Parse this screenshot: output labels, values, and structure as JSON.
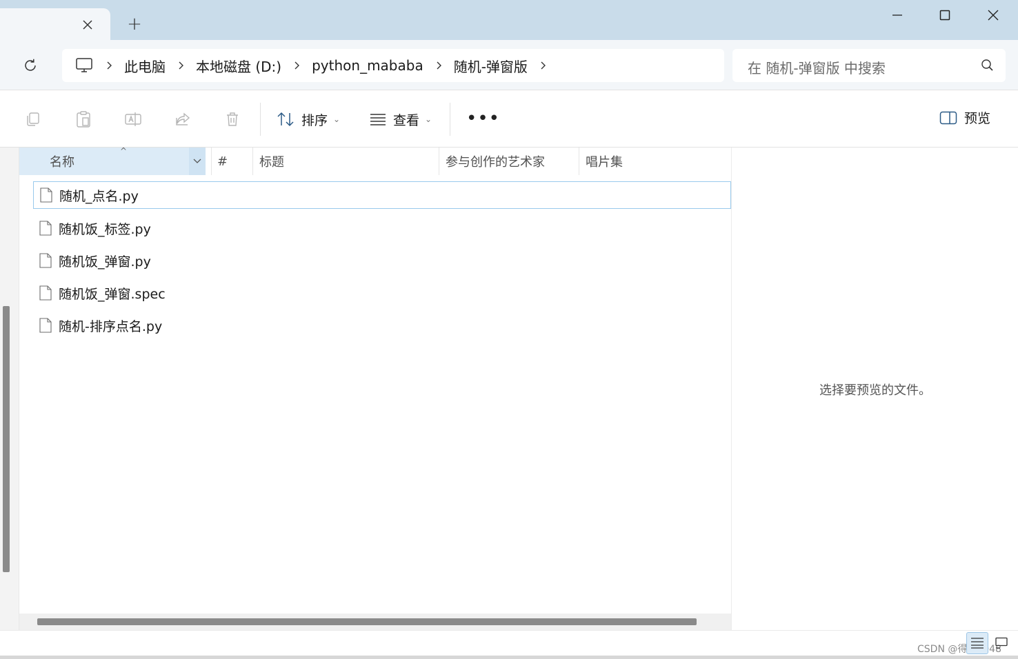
{
  "titlebar": {
    "tab_close_icon": "close-icon",
    "new_tab_label": "+"
  },
  "nav": {
    "breadcrumbs": [
      "此电脑",
      "本地磁盘 (D:)",
      "python_mababa",
      "随机-弹窗版"
    ],
    "search_placeholder": "在 随机-弹窗版 中搜索"
  },
  "toolbar": {
    "sort_label": "排序",
    "view_label": "查看",
    "more_label": "•••",
    "preview_label": "预览"
  },
  "columns": {
    "name": "名称",
    "number": "#",
    "title": "标题",
    "artists": "参与创作的艺术家",
    "album": "唱片集"
  },
  "files": [
    {
      "name": "随机_点名.py",
      "selected": true
    },
    {
      "name": "随机饭_标签.py",
      "selected": false
    },
    {
      "name": "随机饭_弹窗.py",
      "selected": false
    },
    {
      "name": "随机饭_弹窗.spec",
      "selected": false
    },
    {
      "name": "随机-排序点名.py",
      "selected": false
    }
  ],
  "preview_pane": {
    "message": "选择要预览的文件。"
  },
  "watermark": "CSDN @得鹿2048",
  "colors": {
    "titlebar": "#c9dcea",
    "selection": "#dcebf7",
    "selection_border": "#99c9ec"
  }
}
